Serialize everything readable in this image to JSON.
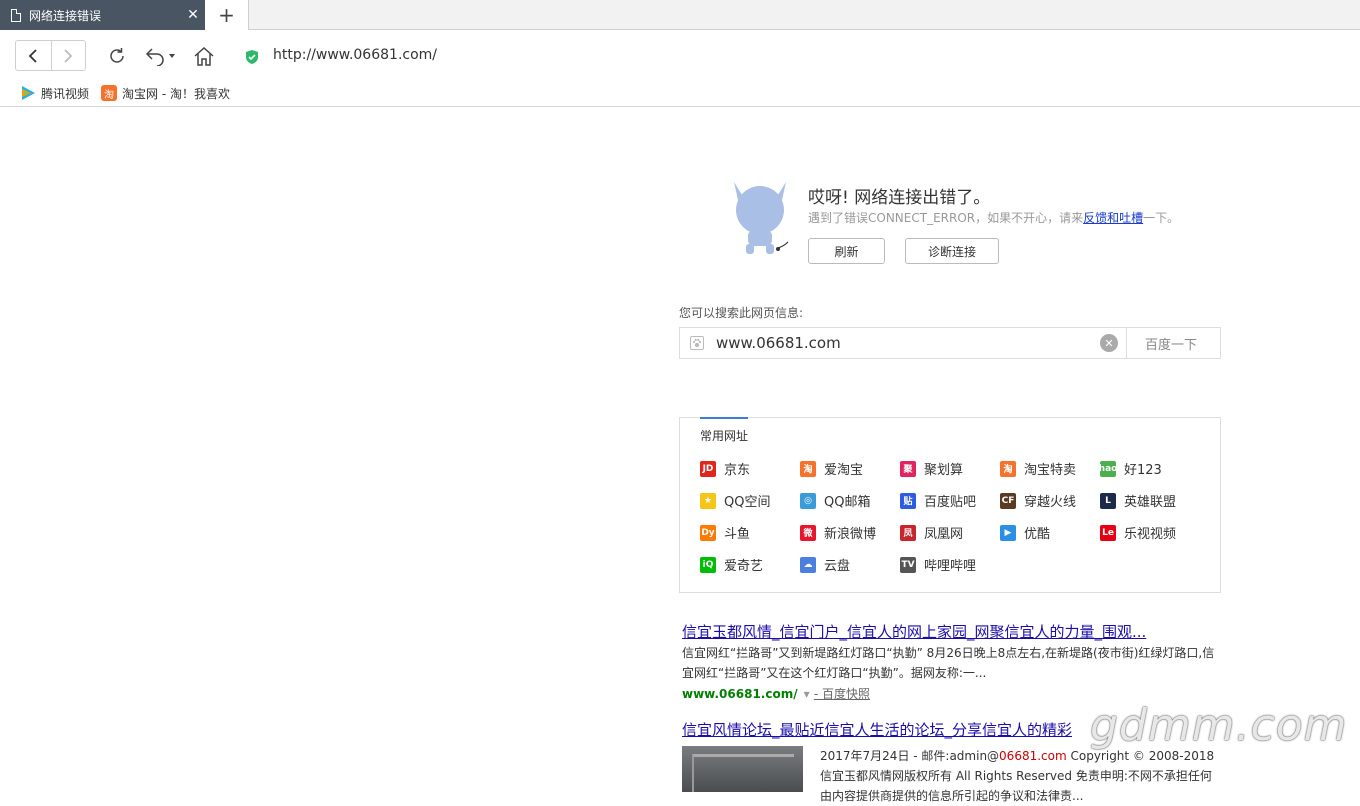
{
  "tab": {
    "title": "网络连接错误"
  },
  "address": {
    "url": "http://www.06681.com/"
  },
  "bookmarks": [
    {
      "label": "腾讯视频",
      "icon": "tencent-video-icon"
    },
    {
      "label": "淘宝网 - 淘！我喜欢",
      "icon": "taobao-icon"
    }
  ],
  "error": {
    "title": "哎呀! 网络连接出错了。",
    "desc_prefix": "遇到了错误CONNECT_ERROR，如果不开心，请来",
    "desc_link": "反馈和吐槽",
    "desc_suffix": "一下。",
    "refresh_label": "刷新",
    "diagnose_label": "诊断连接"
  },
  "search": {
    "label": "您可以搜索此网页信息:",
    "value": "www.06681.com",
    "button": "百度一下"
  },
  "sites": {
    "header": "常用网址",
    "items": [
      {
        "label": "京东",
        "icon": "jd-icon",
        "color": "#e1251b",
        "glyph": "JD"
      },
      {
        "label": "爱淘宝",
        "icon": "aitaobao-icon",
        "color": "#f4722b",
        "glyph": "淘"
      },
      {
        "label": "聚划算",
        "icon": "juhuasuan-icon",
        "color": "#e0245e",
        "glyph": "聚"
      },
      {
        "label": "淘宝特卖",
        "icon": "taobao-temai-icon",
        "color": "#f4722b",
        "glyph": "淘"
      },
      {
        "label": "好123",
        "icon": "hao123-icon",
        "color": "#4caf50",
        "glyph": "hao"
      },
      {
        "label": "QQ空间",
        "icon": "qzone-icon",
        "color": "#f5c518",
        "glyph": "★"
      },
      {
        "label": "QQ邮箱",
        "icon": "qqmail-icon",
        "color": "#3a9bd9",
        "glyph": "◎"
      },
      {
        "label": "百度贴吧",
        "icon": "tieba-icon",
        "color": "#2d5be3",
        "glyph": "贴"
      },
      {
        "label": "穿越火线",
        "icon": "cf-icon",
        "color": "#5a3a22",
        "glyph": "CF"
      },
      {
        "label": "英雄联盟",
        "icon": "lol-icon",
        "color": "#1e2a4a",
        "glyph": "L"
      },
      {
        "label": "斗鱼",
        "icon": "douyu-icon",
        "color": "#ff7a00",
        "glyph": "Dy"
      },
      {
        "label": "新浪微博",
        "icon": "weibo-icon",
        "color": "#e6162d",
        "glyph": "微"
      },
      {
        "label": "凤凰网",
        "icon": "ifeng-icon",
        "color": "#c8242c",
        "glyph": "凤"
      },
      {
        "label": "优酷",
        "icon": "youku-icon",
        "color": "#2b8fe6",
        "glyph": "▶"
      },
      {
        "label": "乐视视频",
        "icon": "letv-icon",
        "color": "#e60012",
        "glyph": "Le"
      },
      {
        "label": "爱奇艺",
        "icon": "iqiyi-icon",
        "color": "#00be06",
        "glyph": "iQ"
      },
      {
        "label": "云盘",
        "icon": "yunpan-icon",
        "color": "#4a7fe0",
        "glyph": "☁"
      },
      {
        "label": "哔哩哔哩",
        "icon": "bilibili-icon",
        "color": "#555555",
        "glyph": "TV"
      }
    ]
  },
  "results": [
    {
      "title": "信宜玉都风情_信宜门户_信宜人的网上家园_网聚信宜人的力量_围观...",
      "snippet": "信宜网红“拦路哥”又到新堤路红灯路口“执勤” 8月26日晚上8点左右,在新堤路(夜市街)红绿灯路口,信宜网红“拦路哥”又在这个红灯路口“执勤”。据网友称:一...",
      "url": "www.06681.com/",
      "url_sep": "▾",
      "cache": "- 百度快照"
    },
    {
      "title": "信宜风情论坛_最贴近信宜人生活的论坛_分享信宜人的精彩",
      "date": "2017年7月24日 - 邮件:admin@",
      "domain_red": "06681.com",
      "snippet_rest": " Copyright © 2008-2018 信宜玉都风情网版权所有 All Rights Reserved 免责申明:不网不承担任何由内容提供商提供的信息所引起的争议和法律责..."
    }
  ],
  "watermark": "gdmm.com"
}
